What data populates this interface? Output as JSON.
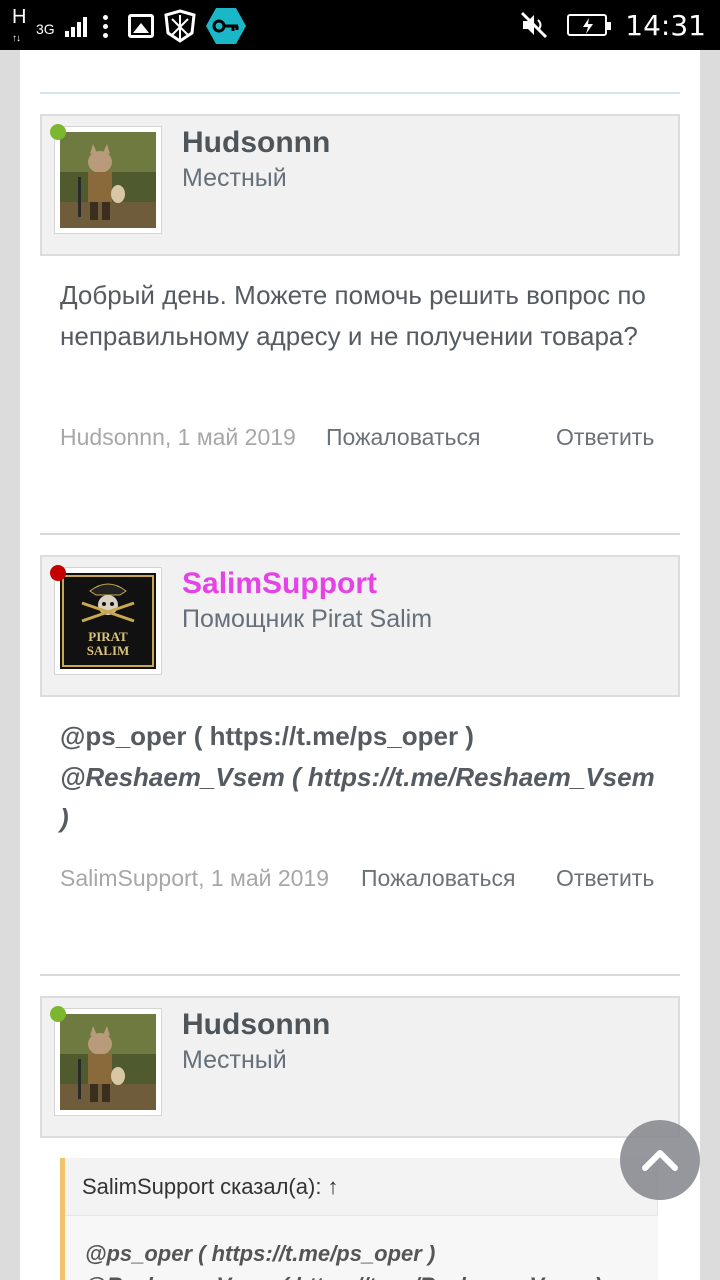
{
  "status_bar": {
    "network": "H",
    "network_type": "3G",
    "time": "14:31"
  },
  "posts": [
    {
      "author": "Hudsonnn",
      "author_title": "Местный",
      "online": true,
      "online_color": "#7cb82f",
      "message": "Добрый день. Можете помочь решить вопрос по неправильному адресу и не получении товара?",
      "meta": "Hudsonnn, 1 май 2019",
      "report": "Пожаловаться",
      "reply": "Ответить"
    },
    {
      "author": "SalimSupport",
      "author_title": "Помощник Pirat Salim",
      "online": false,
      "online_color": "#c40000",
      "author_color": "#e542e8",
      "avatar_text": [
        "PIRAT",
        "SALIM"
      ],
      "message_line1": "@ps_oper ( https://t.me/ps_oper )",
      "message_line2": "@Reshaem_Vsem ( https://t.me/Reshaem_Vsem",
      "message_line3": ")",
      "meta": "SalimSupport, 1 май 2019",
      "report": "Пожаловаться",
      "reply": "Ответить"
    },
    {
      "author": "Hudsonnn",
      "author_title": "Местный",
      "online": true,
      "online_color": "#7cb82f",
      "quote_header": "SalimSupport сказал(а): ↑",
      "quote_line1": "@ps_oper ( https://t.me/ps_oper )",
      "quote_line2": "@Reshaem_Vsem ( https://t.me/Reshaem_Vsem )"
    }
  ],
  "colors": {
    "quote_border": "#f0c36c",
    "scroll_button": "#82858c"
  }
}
